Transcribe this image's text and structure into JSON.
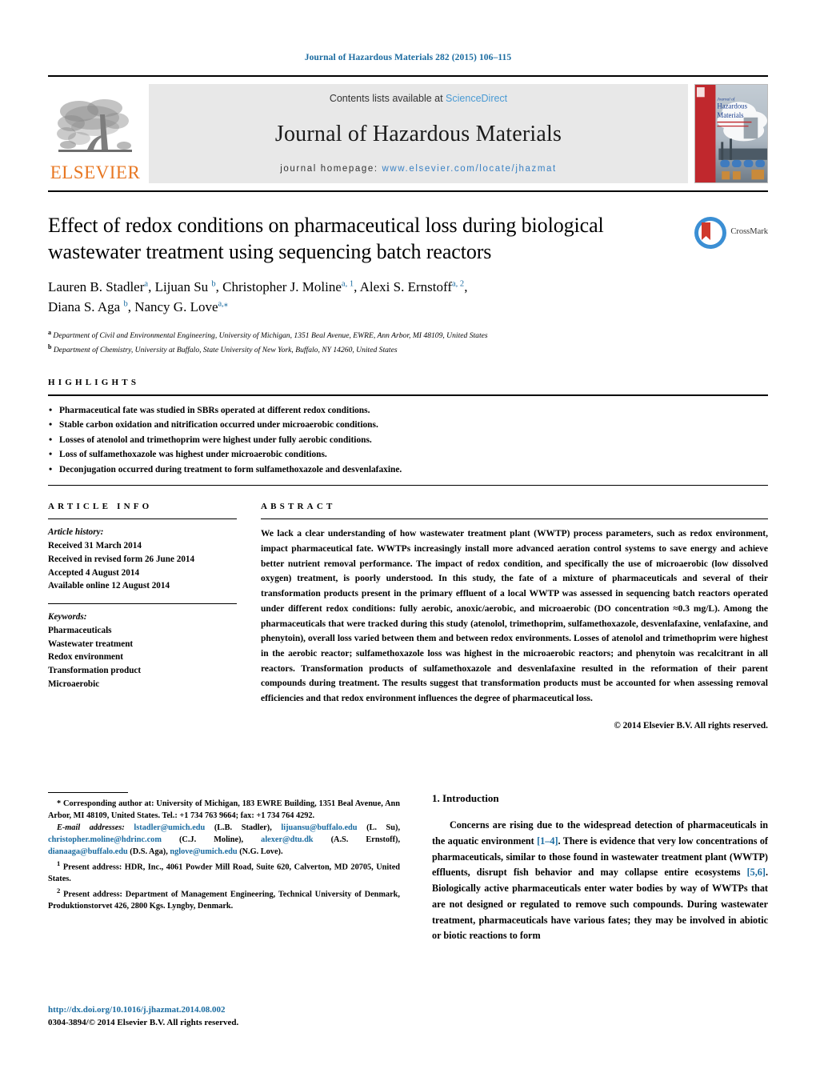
{
  "running_head": "Journal of Hazardous Materials 282 (2015) 106–115",
  "masthead": {
    "publisher_name": "ELSEVIER",
    "contents_prefix": "Contents lists available at ",
    "contents_link": "ScienceDirect",
    "journal_title": "Journal of Hazardous Materials",
    "homepage_prefix": "journal homepage: ",
    "homepage_url": "www.elsevier.com/locate/jhazmat",
    "cover_title_line1": "Journal of",
    "cover_title_line2": "Hazardous",
    "cover_title_line3": "Materials"
  },
  "article": {
    "title": "Effect of redox conditions on pharmaceutical loss during biological wastewater treatment using sequencing batch reactors",
    "authors_line1": "Lauren B. Stadler<sup>a</sup>, Lijuan Su <sup>b</sup>, Christopher J. Moline<sup>a, 1</sup>, Alexi S. Ernstoff<sup>a, 2</sup>,",
    "authors_line2": "Diana S. Aga <sup>b</sup>, Nancy G. Love<sup>a,⁎</sup>",
    "affiliation_a": "<sup>a</sup> Department of Civil and Environmental Engineering, University of Michigan, 1351 Beal Avenue, EWRE, Ann Arbor, MI 48109, United States",
    "affiliation_b": "<sup>b</sup> Department of Chemistry, University at Buffalo, State University of New York, Buffalo, NY 14260, United States",
    "crossmark_label": "CrossMark"
  },
  "highlights": {
    "label": "HIGHLIGHTS",
    "items": [
      "Pharmaceutical fate was studied in SBRs operated at different redox conditions.",
      "Stable carbon oxidation and nitrification occurred under microaerobic conditions.",
      "Losses of atenolol and trimethoprim were highest under fully aerobic conditions.",
      "Loss of sulfamethoxazole was highest under microaerobic conditions.",
      "Deconjugation occurred during treatment to form sulfamethoxazole and desvenlafaxine."
    ]
  },
  "article_info": {
    "label": "ARTICLE INFO",
    "history_label": "Article history:",
    "history": [
      "Received 31 March 2014",
      "Received in revised form 26 June 2014",
      "Accepted 4 August 2014",
      "Available online 12 August 2014"
    ],
    "keywords_label": "Keywords:",
    "keywords": [
      "Pharmaceuticals",
      "Wastewater treatment",
      "Redox environment",
      "Transformation product",
      "Microaerobic"
    ]
  },
  "abstract": {
    "label": "ABSTRACT",
    "text": "We lack a clear understanding of how wastewater treatment plant (WWTP) process parameters, such as redox environment, impact pharmaceutical fate. WWTPs increasingly install more advanced aeration control systems to save energy and achieve better nutrient removal performance. The impact of redox condition, and specifically the use of microaerobic (low dissolved oxygen) treatment, is poorly understood. In this study, the fate of a mixture of pharmaceuticals and several of their transformation products present in the primary effluent of a local WWTP was assessed in sequencing batch reactors operated under different redox conditions: fully aerobic, anoxic/aerobic, and microaerobic (DO concentration ≈0.3 mg/L). Among the pharmaceuticals that were tracked during this study (atenolol, trimethoprim, sulfamethoxazole, desvenlafaxine, venlafaxine, and phenytoin), overall loss varied between them and between redox environments. Losses of atenolol and trimethoprim were highest in the aerobic reactor; sulfamethoxazole loss was highest in the microaerobic reactors; and phenytoin was recalcitrant in all reactors. Transformation products of sulfamethoxazole and desvenlafaxine resulted in the reformation of their parent compounds during treatment. The results suggest that transformation products must be accounted for when assessing removal efficiencies and that redox environment influences the degree of pharmaceutical loss.",
    "copyright": "© 2014 Elsevier B.V. All rights reserved."
  },
  "footnotes": {
    "corresponding": "* Corresponding author at: University of Michigan, 183 EWRE Building, 1351 Beal Avenue, Ann Arbor, MI 48109, United States. Tel.: +1 734 763 9664; fax: +1 734 764 4292.",
    "emails_label": "E-mail addresses:",
    "emails": [
      {
        "address": "lstadler@umich.edu",
        "owner": "(L.B. Stadler)"
      },
      {
        "address": "lijuansu@buffalo.edu",
        "owner": "(L. Su)"
      },
      {
        "address": "christopher.moline@hdrinc.com",
        "owner": "(C.J. Moline)"
      },
      {
        "address": "alexer@dtu.dk",
        "owner": "(A.S. Ernstoff)"
      },
      {
        "address": "dianaaga@buffalo.edu",
        "owner": "(D.S. Aga)"
      },
      {
        "address": "nglove@umich.edu",
        "owner": "(N.G. Love)"
      }
    ],
    "present_address_1": "Present address: HDR, Inc., 4061 Powder Mill Road, Suite 620, Calverton, MD 20705, United States.",
    "present_address_2": "Present address: Department of Management Engineering, Technical University of Denmark, Produktionstorvet 426, 2800 Kgs. Lyngby, Denmark."
  },
  "doi_block": {
    "doi_url": "http://dx.doi.org/10.1016/j.jhazmat.2014.08.002",
    "issn_line": "0304-3894/© 2014 Elsevier B.V. All rights reserved."
  },
  "introduction": {
    "heading": "1. Introduction",
    "paragraph_1": "Concerns are rising due to the widespread detection of pharmaceuticals in the aquatic environment <span class=\"ref\">[1–4]</span>. There is evidence that very low concentrations of pharmaceuticals, similar to those found in wastewater treatment plant (WWTP) effluents, disrupt fish behavior and may collapse entire ecosystems <span class=\"ref\">[5,6]</span>. Biologically active pharmaceuticals enter water bodies by way of WWTPs that are not designed or regulated to remove such compounds. During wastewater treatment, pharmaceuticals have various fates; they may be involved in abiotic or biotic reactions to form"
  },
  "colors": {
    "link_blue": "#1a6ba0",
    "sciencedirect_blue": "#4a9ad4",
    "elsevier_orange": "#E87722",
    "masthead_gray": "#e8e8e8"
  }
}
